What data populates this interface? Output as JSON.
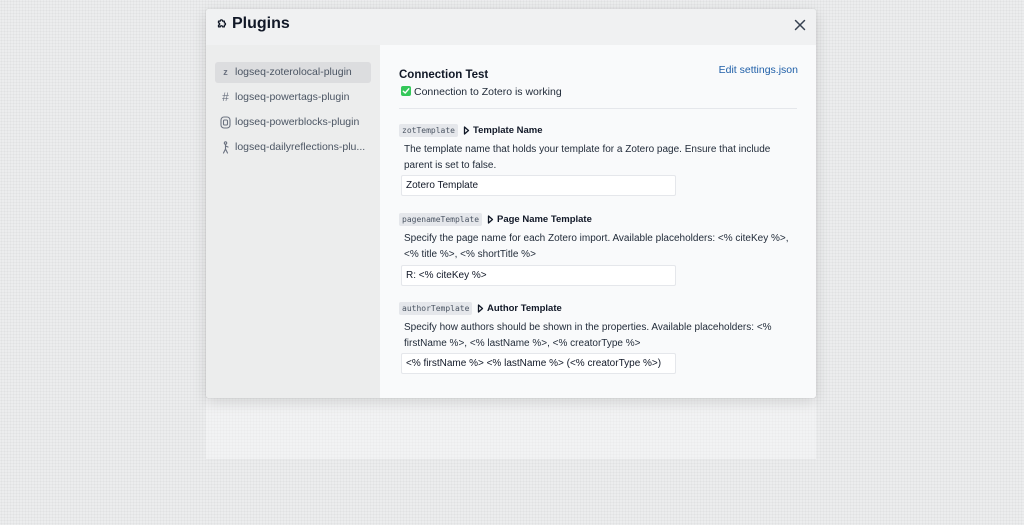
{
  "modal": {
    "title": "Plugins",
    "icon": "puzzle-icon",
    "close_icon": "close-icon"
  },
  "sidebar": {
    "items": [
      {
        "label": "logseq-zoterolocal-plugin",
        "icon": "zotero-z-icon",
        "glyph": "z",
        "active": true
      },
      {
        "label": "logseq-powertags-plugin",
        "icon": "hash-icon",
        "glyph": "#",
        "active": false
      },
      {
        "label": "logseq-powerblocks-plugin",
        "icon": "block-icon",
        "glyph": "",
        "active": false
      },
      {
        "label": "logseq-dailyreflections-plu...",
        "icon": "figure-icon",
        "glyph": "",
        "active": false
      }
    ]
  },
  "content": {
    "connection_title": "Connection Test",
    "edit_link": "Edit settings.json",
    "connection_status": "Connection to Zotero is working",
    "status_color": "#34c759",
    "link_color": "#1f5fa8"
  },
  "settings": [
    {
      "key": "zotTemplate",
      "title": "Template Name",
      "description": "The template name that holds your template for a Zotero page. Ensure that include parent is set to false.",
      "value": "Zotero Template"
    },
    {
      "key": "pagenameTemplate",
      "title": "Page Name Template",
      "description": "Specify the page name for each Zotero import. Available placeholders: <% citeKey %>, <% title %>, <% shortTitle %>",
      "value": "R: <% citeKey %>"
    },
    {
      "key": "authorTemplate",
      "title": "Author Template",
      "description": "Specify how authors should be shown in the properties. Available placeholders: <% firstName %>, <% lastName %>, <% creatorType %>",
      "value": "<% firstName %> <% lastName %> (<% creatorType %>)"
    }
  ]
}
